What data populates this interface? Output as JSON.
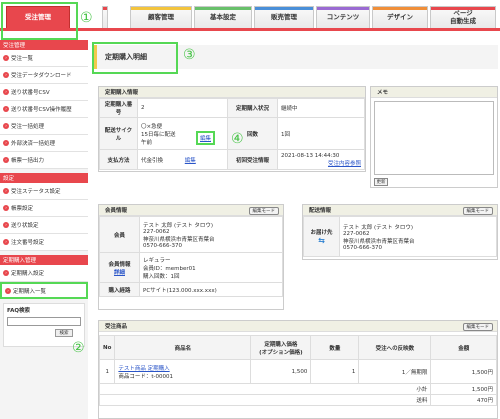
{
  "nav": {
    "tabs": [
      {
        "label": "受注管理",
        "stripe": "#e8474d"
      },
      {
        "label": "顧客管理",
        "stripe": "#f3c43d"
      },
      {
        "label": "基本設定",
        "stripe": "#68c06a"
      },
      {
        "label": "販売管理",
        "stripe": "#4a8fd8"
      },
      {
        "label": "コンテンツ",
        "stripe": "#9a6ad2"
      },
      {
        "label": "デザイン",
        "stripe": "#f08f3a"
      },
      {
        "label": "ページ\n自動生成",
        "stripe": "#e8474d"
      }
    ]
  },
  "callouts": [
    "①",
    "②",
    "③",
    "④"
  ],
  "sidebar": {
    "section1": "受注管理",
    "items1": [
      "受注一覧",
      "受注データダウンロード",
      "送り状番号CSV",
      "送り状番号CSV操作履歴",
      "受注一括処理",
      "外部決済一括処理",
      "帳票一括出力"
    ],
    "section2": "設定",
    "items2": [
      "受注ステータス設定",
      "帳票設定",
      "送り状設定",
      "注文番号設定"
    ],
    "section3": "定期購入管理",
    "items3": [
      "定期購入設定",
      "定期購入一覧"
    ],
    "faq_title": "FAQ検索",
    "faq_button": "検索"
  },
  "page_title": "定期購入明細",
  "info": {
    "head": "定期購入情報",
    "order_no_label": "定期購入番号",
    "order_no": "2",
    "status_label": "定期購入状況",
    "status": "継続中",
    "cycle_label": "配送サイクル",
    "cycle_lines": [
      "〇×急便",
      "15日毎に配送",
      "午前"
    ],
    "edit_link": "編集",
    "count_label": "回数",
    "count_value": "1回",
    "payment_label": "支払方法",
    "payment": "代金引換",
    "payment_edit": "編集",
    "first_date_label": "初回受注情報",
    "first_date": "2021-08-13 14:44:30",
    "first_link": "受注内容参照"
  },
  "memo": {
    "head": "メモ",
    "button": "更新"
  },
  "member": {
    "head": "会員情報",
    "edit": "編集モード",
    "label_member": "会員",
    "name": "テスト 太郎 (テスト タロウ)",
    "zip": "227-0062",
    "address": "神奈川県横浜市青葉区青葉台",
    "tel": "0570-666-370",
    "label_info": "会員情報",
    "label_info_link": "詳細",
    "rank": "レギュラー",
    "member_id": "会員ID：member01",
    "purchases": "購入回数：1回",
    "label_route": "購入経路",
    "route": "PCサイト(123.000.xxx.xxx)"
  },
  "ship": {
    "head": "配送情報",
    "edit": "編集モード",
    "label": "お届け先",
    "name": "テスト 太郎 (テスト タロウ)",
    "zip": "227-0062",
    "address": "神奈川県横浜市青葉区青葉台",
    "tel": "0570-666-370"
  },
  "products": {
    "head": "受注商品",
    "edit": "編集モード",
    "columns": [
      "No",
      "商品名",
      "定期購入価格\n(オプション価格)",
      "数量",
      "受注への反映数",
      "金額"
    ],
    "rows": [
      {
        "no": "1",
        "name": "テスト商品 定期購入",
        "code": "商品コード：t-00001",
        "price": "1,500",
        "qty": "1",
        "reflect": "1／無期限",
        "amount": "1,500円"
      }
    ],
    "subtotal_label": "小計",
    "subtotal": "1,500円",
    "shipping_label": "送料",
    "shipping": "470円"
  }
}
